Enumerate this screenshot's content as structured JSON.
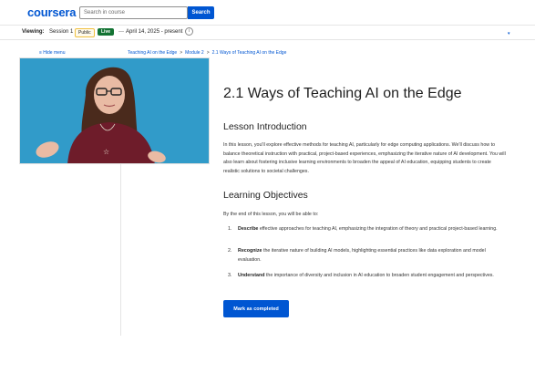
{
  "header": {
    "logo": "coursera",
    "search_placeholder": "Search in course",
    "search_button": "Search"
  },
  "viewbar": {
    "label": "Viewing:",
    "session": "Session 1",
    "public_badge": "Public",
    "live_badge": "Live",
    "dash": "—",
    "dates": "April 14, 2025 - present",
    "info_icon": "i"
  },
  "sidebar": {
    "hide_menu": "≡ Hide menu"
  },
  "breadcrumb": {
    "items": [
      "Teaching AI on the Edge",
      "Module 2",
      "2.1 Ways of Teaching AI on the Edge"
    ],
    "separator": ">"
  },
  "main": {
    "title": "2.1 Ways of Teaching AI on the Edge",
    "intro_heading": "Lesson Introduction",
    "intro_text": "In this lesson, you'll explore effective methods for teaching AI, particularly for edge computing applications. We'll discuss how to balance theoretical instruction with practical, project-based experiences, emphasizing the iterative nature of AI development. You will also learn about fostering inclusive learning environments to broaden the appeal of AI education, equipping students to create realistic solutions to societal challenges.",
    "objectives_heading": "Learning Objectives",
    "objectives_intro": "By the end of this lesson, you will be able to:",
    "objectives": [
      {
        "num": "1.",
        "bold": "Describe",
        "rest": " effective approaches for teaching AI, emphasizing the integration of theory and practical project-based learning."
      },
      {
        "num": "2.",
        "bold": "Recognize",
        "rest": " the iterative nature of building AI models, highlighting essential practices like data exploration and model evaluation."
      },
      {
        "num": "3.",
        "bold": "Understand",
        "rest": " the importance of diversity and inclusion in AI education to broaden student engagement and perspectives."
      }
    ],
    "complete_button": "Mark as completed"
  },
  "colors": {
    "brand": "#0056d2",
    "live": "#137333",
    "video_bg": "#2d96c4"
  },
  "icons": {
    "info": "info-icon",
    "caret": "chevron-down-icon",
    "menu": "hamburger-icon"
  }
}
